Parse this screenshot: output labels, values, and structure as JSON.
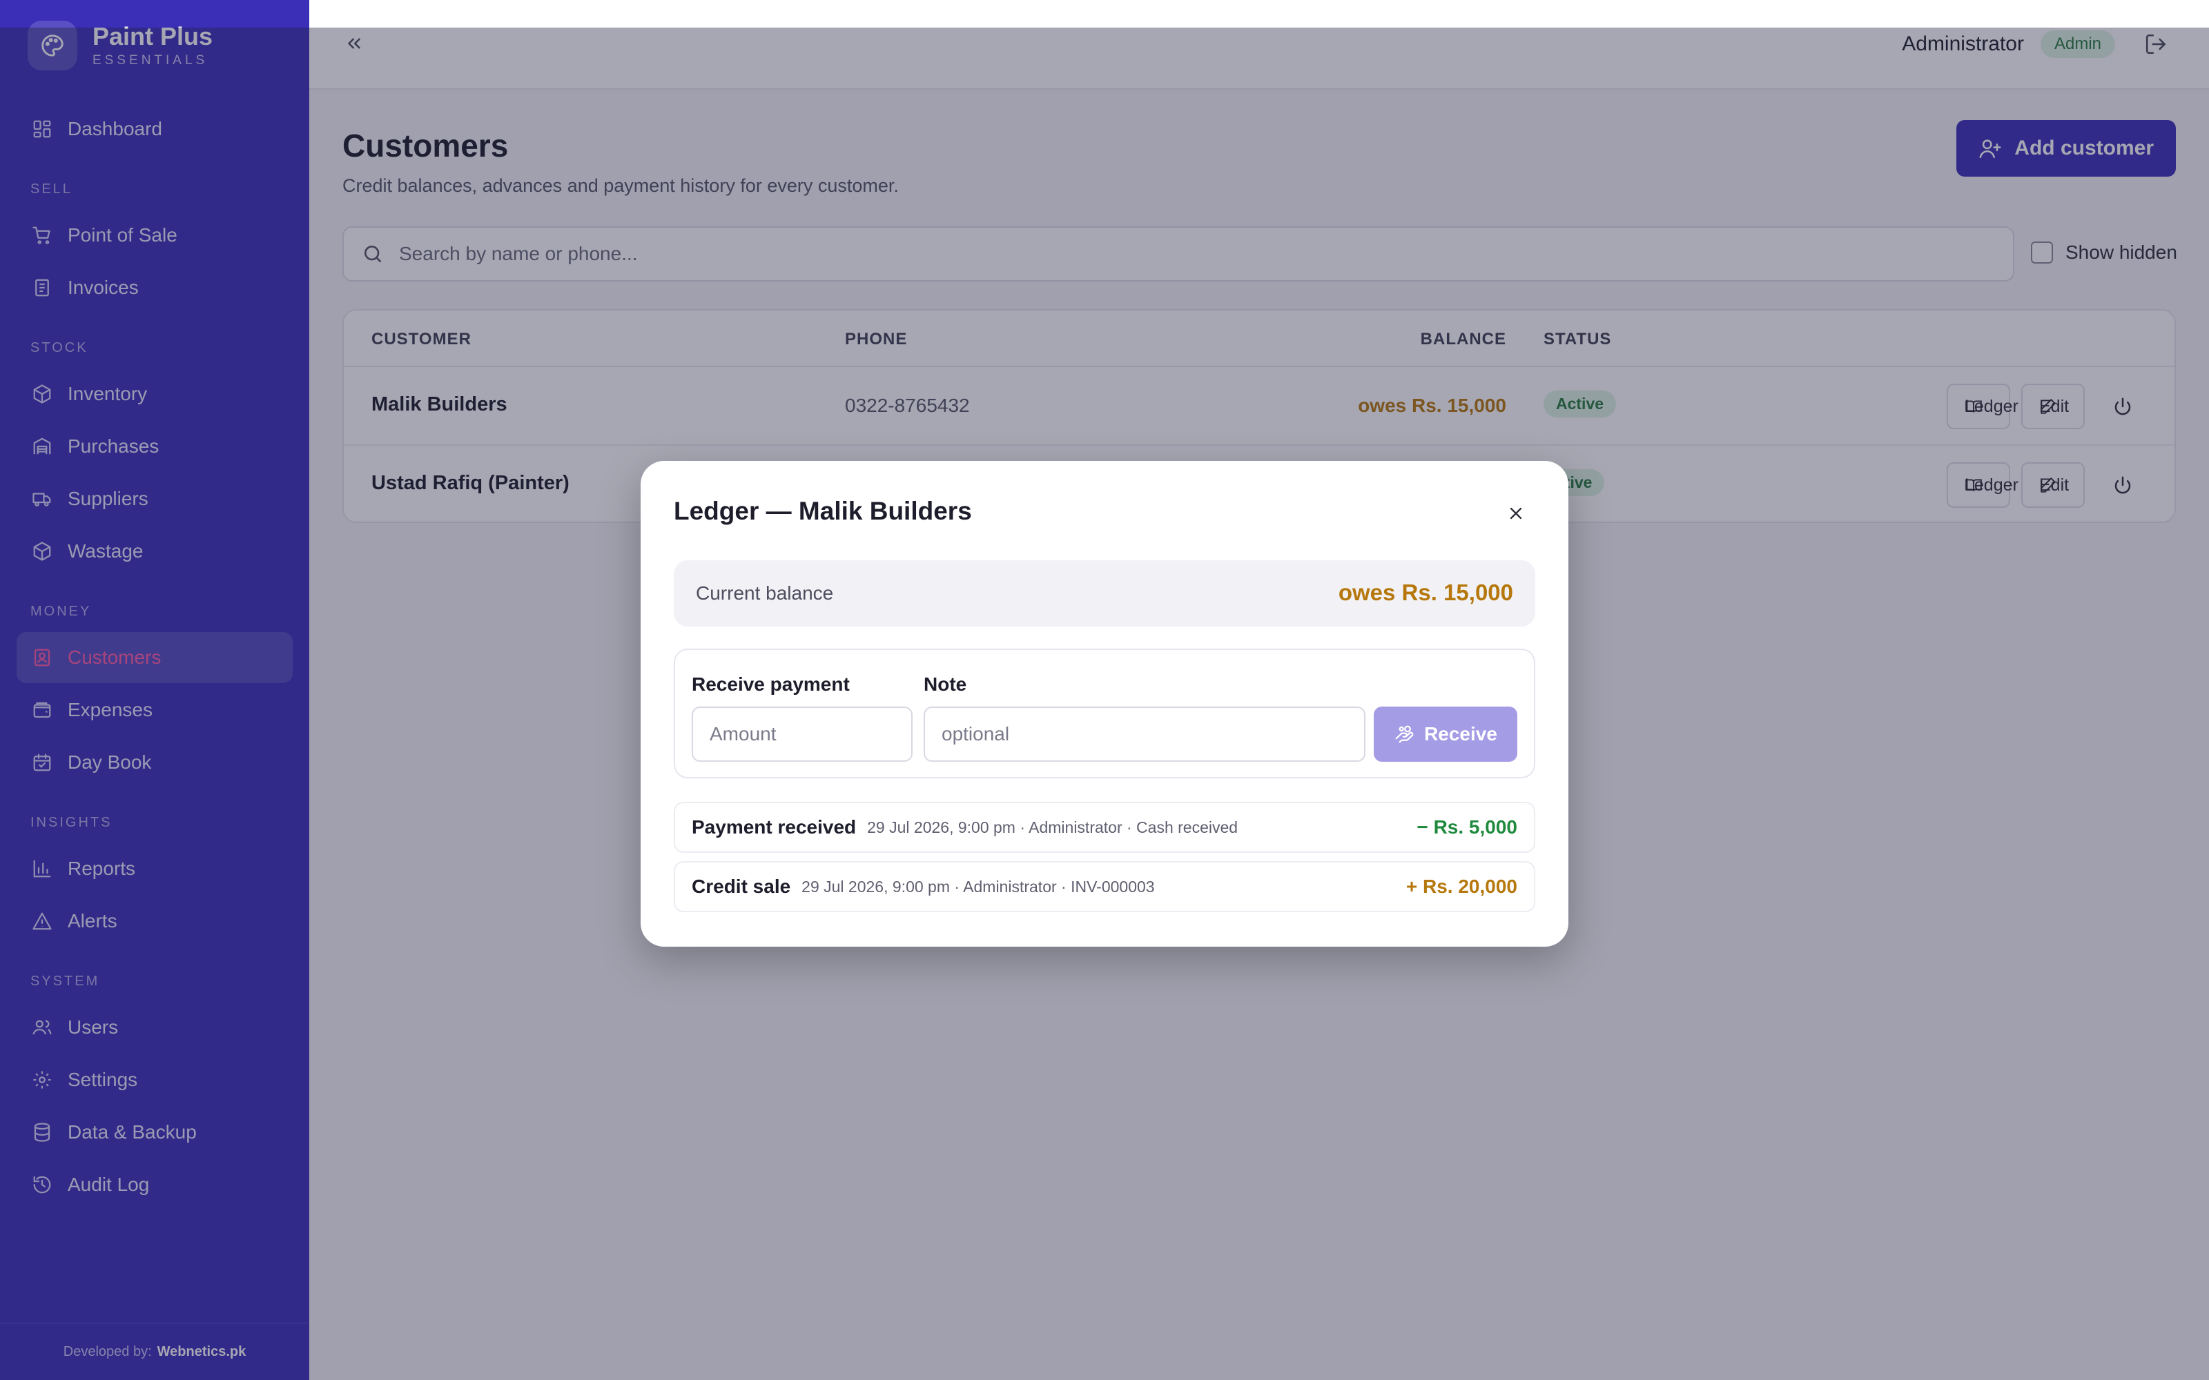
{
  "app": {
    "name": "Paint Plus",
    "subtitle": "ESSENTIALS",
    "footer_prefix": "Developed by:",
    "footer_brand": "Webnetics.pk"
  },
  "sidebar": {
    "dashboard": "Dashboard",
    "sections": {
      "sell": "SELL",
      "stock": "STOCK",
      "money": "MONEY",
      "insights": "INSIGHTS",
      "system": "SYSTEM"
    },
    "items": {
      "pos": "Point of Sale",
      "invoices": "Invoices",
      "inventory": "Inventory",
      "purchases": "Purchases",
      "suppliers": "Suppliers",
      "wastage": "Wastage",
      "customers": "Customers",
      "expenses": "Expenses",
      "daybook": "Day Book",
      "reports": "Reports",
      "alerts": "Alerts",
      "users": "Users",
      "settings": "Settings",
      "backup": "Data & Backup",
      "audit": "Audit Log"
    },
    "active": "customers"
  },
  "header": {
    "user": "Administrator",
    "role": "Admin"
  },
  "page": {
    "title": "Customers",
    "subtitle": "Credit balances, advances and payment history for every customer.",
    "add_button": "Add customer",
    "search_placeholder": "Search by name or phone...",
    "show_hidden": "Show hidden"
  },
  "table": {
    "headers": {
      "customer": "CUSTOMER",
      "phone": "PHONE",
      "balance": "BALANCE",
      "status": "STATUS"
    },
    "rows": [
      {
        "name": "Malik Builders",
        "phone": "0322-8765432",
        "balance": "owes Rs. 15,000",
        "status": "Active"
      },
      {
        "name": "Ustad Rafiq (Painter)",
        "phone": "",
        "balance": "",
        "status": "ctive"
      }
    ],
    "actions": {
      "ledger": "Ledger",
      "edit": "Edit"
    }
  },
  "modal": {
    "title": "Ledger — Malik Builders",
    "balance_label": "Current balance",
    "balance_value": "owes Rs. 15,000",
    "receive_label": "Receive payment",
    "note_label": "Note",
    "amount_placeholder": "Amount",
    "note_placeholder": "optional",
    "receive_button": "Receive",
    "entries": [
      {
        "title": "Payment received",
        "meta": "29 Jul 2026, 9:00 pm · Administrator · Cash received",
        "amount": "− Rs. 5,000",
        "color": "#1f8a3e"
      },
      {
        "title": "Credit sale",
        "meta": "29 Jul 2026, 9:00 pm · Administrator · INV-000003",
        "amount": "+ Rs. 20,000",
        "color": "#b6780c"
      }
    ]
  },
  "colors": {
    "sidebar": "#3b2fb8",
    "accent_active": "#ff5aa3",
    "owes": "#b6780c",
    "success": "#1f8a3e"
  }
}
